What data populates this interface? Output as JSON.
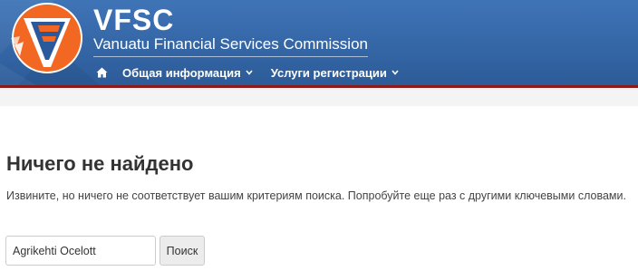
{
  "header": {
    "brand_abbr": "VFSC",
    "brand_name": "Vanuatu Financial Services Commission",
    "logo_icon": "vfsc-logo-icon",
    "colors": {
      "header_bg": "#3a6cad",
      "accent_border": "#8b1a1a",
      "logo_orange": "#f26722",
      "logo_blue": "#2a5a9c"
    }
  },
  "nav": {
    "home_icon": "home-icon",
    "items": [
      {
        "label": "Общая информация",
        "icon": "chevron-down-icon"
      },
      {
        "label": "Услуги регистрации",
        "icon": "chevron-down-icon"
      }
    ]
  },
  "content": {
    "title": "Ничего не найдено",
    "message": "Извините, но ничего не соответствует вашим критериям поиска. Попробуйте еще раз с другими ключевыми словами."
  },
  "search": {
    "value": "Agrikehti Ocelott",
    "button_label": "Поиск"
  }
}
